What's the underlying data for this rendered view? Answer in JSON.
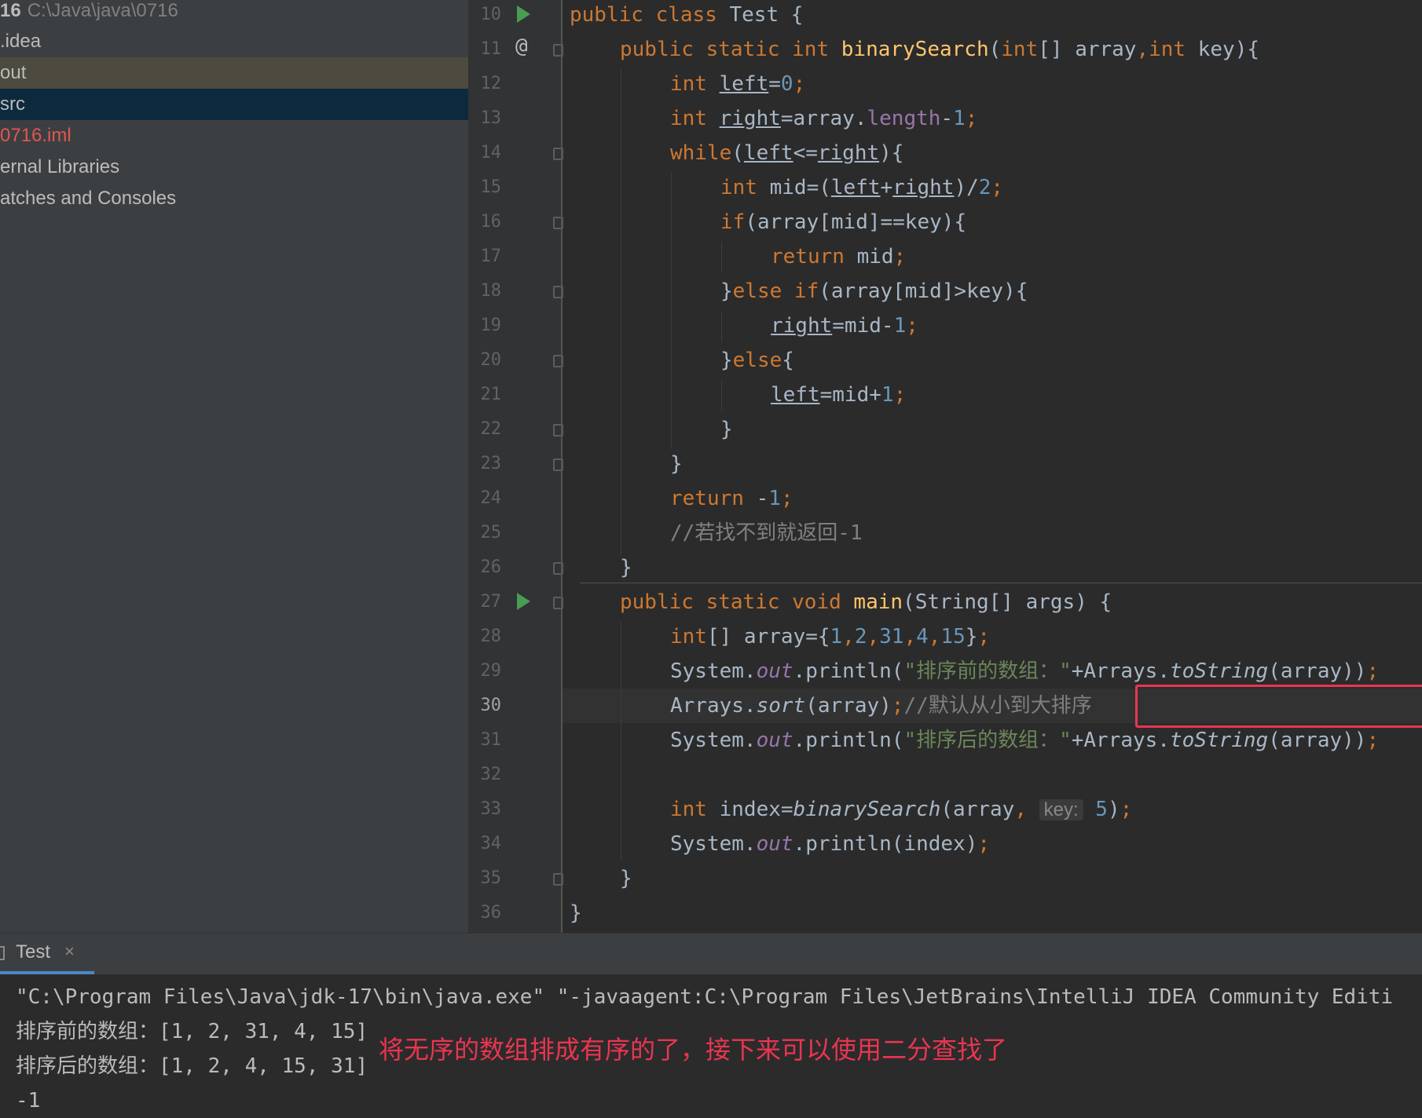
{
  "project": {
    "root_number": "16",
    "root_path": "C:\\Java\\java\\0716",
    "items": [
      {
        "label": ".idea"
      },
      {
        "label": "out"
      },
      {
        "label": "src"
      },
      {
        "label": "0716.iml"
      },
      {
        "label": "ernal Libraries"
      },
      {
        "label": "atches and Consoles"
      }
    ]
  },
  "editor": {
    "line_numbers": [
      "10",
      "11",
      "12",
      "13",
      "14",
      "15",
      "16",
      "17",
      "18",
      "19",
      "20",
      "21",
      "22",
      "23",
      "24",
      "25",
      "26",
      "27",
      "28",
      "29",
      "30",
      "31",
      "32",
      "33",
      "34",
      "35",
      "36"
    ],
    "current_line": "30",
    "colors": {
      "keyword": "#cc7832",
      "function": "#ffc66d",
      "number": "#6897bb",
      "field": "#9876aa",
      "string": "#6a8759",
      "comment": "#808080",
      "highlight": "#ea3550"
    },
    "code": {
      "l10": {
        "kw": "public class",
        "rest": " Test {"
      },
      "l11": {
        "kw1": "public static int",
        "fn": "binarySearch",
        "p1": "(",
        "kw2": "int",
        "p2": "[] array",
        "comma": ",",
        "kw3": "int",
        "p3": " key){"
      },
      "l12": {
        "kw": "int",
        "var": "left",
        "eq": "=",
        "num": "0",
        "semi": ";"
      },
      "l13": {
        "kw": "int",
        "var": "right",
        "eq": "=array.",
        "fld": "length",
        "op": "-",
        "num": "1",
        "semi": ";"
      },
      "l14": {
        "kw": "while",
        "p1": "(",
        "var1": "left",
        "op": "<=",
        "var2": "right",
        "p2": "){"
      },
      "l15": {
        "kw": "int",
        "p1": " mid=(",
        "var1": "left",
        "op": "+",
        "var2": "right",
        "p2": ")/",
        "num": "2",
        "semi": ";"
      },
      "l16": {
        "kw": "if",
        "rest": "(array[mid]==key){"
      },
      "l17": {
        "kw": "return",
        "rest": " mid",
        "semi": ";"
      },
      "l18": {
        "p1": "}",
        "kw": "else if",
        "rest": "(array[mid]>key){"
      },
      "l19": {
        "var": "right",
        "rest": "=mid-",
        "num": "1",
        "semi": ";"
      },
      "l20": {
        "p1": "}",
        "kw": "else",
        "p2": "{"
      },
      "l21": {
        "var": "left",
        "rest": "=mid+",
        "num": "1",
        "semi": ";"
      },
      "l22": {
        "text": "}"
      },
      "l23": {
        "text": "}"
      },
      "l24": {
        "kw": "return",
        "rest": " -",
        "num": "1",
        "semi": ";"
      },
      "l25": {
        "cmt": "//若找不到就返回-1"
      },
      "l26": {
        "text": "}"
      },
      "l27": {
        "kw": "public static void",
        "fn": "main",
        "rest": "(String[] args) {"
      },
      "l28": {
        "kw": "int",
        "p1": "[] array={",
        "n1": "1",
        "c1": ",",
        "n2": "2",
        "c2": ",",
        "n3": "31",
        "c3": ",",
        "n4": "4",
        "c4": ",",
        "n5": "15",
        "p2": "}",
        "semi": ";"
      },
      "l29": {
        "p1": "System.",
        "fld": "out",
        "p2": ".println(",
        "str": "\"排序前的数组：\"",
        "p3": "+Arrays.",
        "fn": "toString",
        "p4": "(array))",
        "semi": ";"
      },
      "l30": {
        "p1": "Arrays.",
        "fn": "sort",
        "p2": "(array)",
        "semi": ";",
        "cmt": "//默认从小到大排序"
      },
      "l31": {
        "p1": "System.",
        "fld": "out",
        "p2": ".println(",
        "str": "\"排序后的数组：\"",
        "p3": "+Arrays.",
        "fn": "toString",
        "p4": "(array))",
        "semi": ";"
      },
      "l32": {
        "text": ""
      },
      "l33": {
        "kw": "int",
        "p1": " index=",
        "fn": "binarySearch",
        "p2": "(array",
        "comma": ",",
        "hint": "key:",
        "num": "5",
        "p3": ")",
        "semi": ";"
      },
      "l34": {
        "p1": "System.",
        "fld": "out",
        "p2": ".println(index)",
        "semi": ";"
      },
      "l35": {
        "text": "}"
      },
      "l36": {
        "text": "}"
      }
    }
  },
  "run": {
    "tab_label": "Test",
    "tab_close": "×",
    "output": [
      "\"C:\\Program Files\\Java\\jdk-17\\bin\\java.exe\" \"-javaagent:C:\\Program Files\\JetBrains\\IntelliJ IDEA Community Editi",
      "排序前的数组：[1, 2, 31, 4, 15]",
      "排序后的数组：[1, 2, 4, 15, 31]",
      "-1"
    ],
    "annotation": "将无序的数组排成有序的了，接下来可以使用二分查找了"
  }
}
